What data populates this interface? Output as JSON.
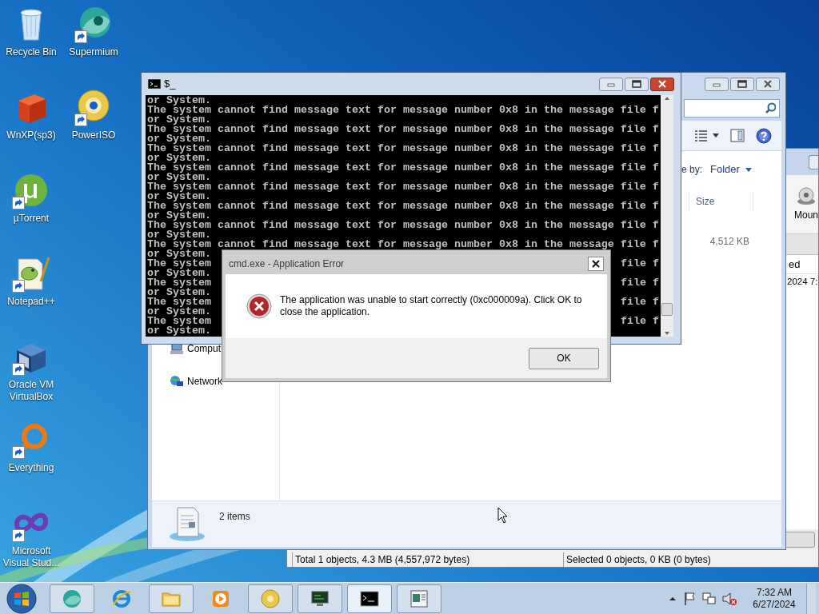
{
  "desktop_icons": [
    {
      "label": "Recycle Bin",
      "shortcut": false
    },
    {
      "label": "WnXP(sp3)",
      "shortcut": false
    },
    {
      "label": "µTorrent",
      "shortcut": true
    },
    {
      "label": "Notepad++",
      "shortcut": true
    },
    {
      "label": "Oracle VM VirtualBox",
      "shortcut": true
    },
    {
      "label": "Everything",
      "shortcut": true
    },
    {
      "label": "Microsoft Visual Stud...",
      "shortcut": true
    },
    {
      "label": "Supermium",
      "shortcut": true
    },
    {
      "label": "PowerISO",
      "shortcut": true
    }
  ],
  "poweriso_window": {
    "toolbar_button": "Moun",
    "column_header": "ed",
    "row_cell": "2024 7:",
    "status_total": "Total 1 objects, 4.3 MB (4,557,972 bytes)",
    "status_selected": "Selected 0 objects, 0 KB (0 bytes)"
  },
  "explorer_window": {
    "arrange_label": "e by:",
    "arrange_value": "Folder",
    "column_header": "Size",
    "file_size": "4,512 KB",
    "nav_items": [
      "Comput",
      "Network"
    ],
    "details": "2 items"
  },
  "console_window": {
    "title": "$_",
    "lines": [
      {
        "kind": "full",
        "text": "or System."
      },
      {
        "kind": "full",
        "text": "The system cannot find message text for message number 0x8 in the message file f"
      },
      {
        "kind": "full",
        "text": "or System."
      },
      {
        "kind": "full",
        "text": "The system cannot find message text for message number 0x8 in the message file f"
      },
      {
        "kind": "full",
        "text": "or System."
      },
      {
        "kind": "full",
        "text": "The system cannot find message text for message number 0x8 in the message file f"
      },
      {
        "kind": "full",
        "text": "or System."
      },
      {
        "kind": "full",
        "text": "The system cannot find message text for message number 0x8 in the message file f"
      },
      {
        "kind": "full",
        "text": "or System."
      },
      {
        "kind": "full",
        "text": "The system cannot find message text for message number 0x8 in the message file f"
      },
      {
        "kind": "full",
        "text": "or System."
      },
      {
        "kind": "full",
        "text": "The system cannot find message text for message number 0x8 in the message file f"
      },
      {
        "kind": "full",
        "text": "or System."
      },
      {
        "kind": "full",
        "text": "The system cannot find message text for message number 0x8 in the message file f"
      },
      {
        "kind": "full",
        "text": "or System."
      },
      {
        "kind": "full",
        "text": "The system cannot find message text for message number 0x8 in the message file f"
      },
      {
        "kind": "full",
        "text": "or System."
      },
      {
        "kind": "split",
        "left": "The system",
        "right": "file f"
      },
      {
        "kind": "full",
        "text": "or System."
      },
      {
        "kind": "split",
        "left": "The system",
        "right": "file f"
      },
      {
        "kind": "full",
        "text": "or System."
      },
      {
        "kind": "split",
        "left": "The system",
        "right": "file f"
      },
      {
        "kind": "full",
        "text": "or System."
      },
      {
        "kind": "split",
        "left": "The system",
        "right": "file f"
      },
      {
        "kind": "full",
        "text": "or System."
      }
    ]
  },
  "error_dialog": {
    "title": "cmd.exe - Application Error",
    "message": "The application was unable to start correctly (0xc000009a). Click OK to close the application.",
    "button": "OK"
  },
  "taskbar": {
    "buttons": [
      {
        "open": true,
        "active": false
      },
      {
        "open": false,
        "active": false
      },
      {
        "open": true,
        "active": false
      },
      {
        "open": false,
        "active": false
      },
      {
        "open": true,
        "active": false
      },
      {
        "open": true,
        "active": false
      },
      {
        "open": true,
        "active": true
      },
      {
        "open": true,
        "active": false
      }
    ],
    "time": "7:32 AM",
    "date": "6/27/2024"
  }
}
